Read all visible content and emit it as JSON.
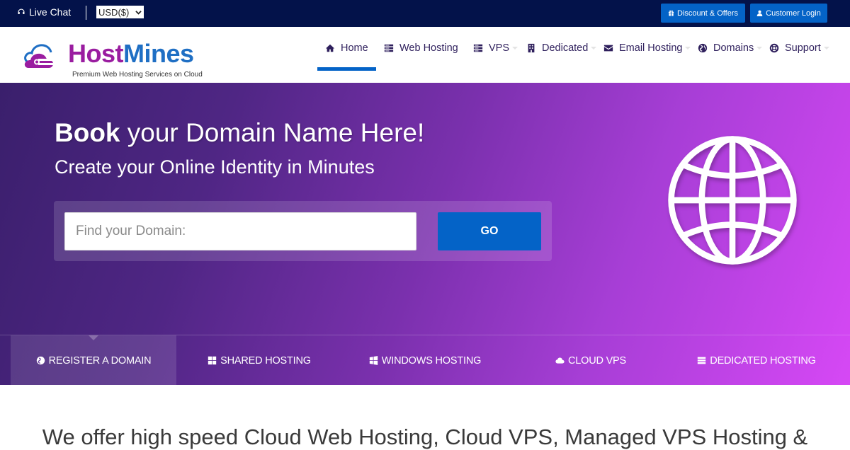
{
  "topbar": {
    "live_chat": "Live Chat",
    "currency": "USD($)",
    "discount_button": "Discount & Offers",
    "login_button": "Customer Login"
  },
  "brand": {
    "name_part1": "Host",
    "name_part2": "Mines",
    "tagline": "Premium Web Hosting Services on Cloud",
    "colors": {
      "host": "#9a1da0",
      "mines": "#1f6fc4"
    }
  },
  "nav": {
    "active": "Home",
    "items": [
      {
        "label": "Home",
        "icon": "home-icon",
        "has_dropdown": false
      },
      {
        "label": "Web Hosting",
        "icon": "server-icon",
        "has_dropdown": false
      },
      {
        "label": "VPS",
        "icon": "server-icon",
        "has_dropdown": true
      },
      {
        "label": "Dedicated",
        "icon": "building-icon",
        "has_dropdown": true
      },
      {
        "label": "Email Hosting",
        "icon": "envelope-icon",
        "has_dropdown": true
      },
      {
        "label": "Domains",
        "icon": "globe-icon",
        "has_dropdown": true
      },
      {
        "label": "Support",
        "icon": "life-ring-icon",
        "has_dropdown": true
      }
    ]
  },
  "hero": {
    "title_bold": "Book",
    "title_rest": " your Domain Name Here!",
    "subtitle": "Create your Online Identity in Minutes",
    "search_placeholder": "Find your Domain:",
    "search_value": "",
    "go_button": "GO"
  },
  "tabs": {
    "active": "REGISTER A DOMAIN",
    "items": [
      {
        "label": "REGISTER A DOMAIN",
        "icon": "globe-icon"
      },
      {
        "label": "SHARED HOSTING",
        "icon": "grid-icon"
      },
      {
        "label": "WINDOWS HOSTING",
        "icon": "windows-icon"
      },
      {
        "label": "CLOUD VPS",
        "icon": "cloud-icon"
      },
      {
        "label": "DEDICATED HOSTING",
        "icon": "server-icon"
      }
    ]
  },
  "intro": {
    "text": "We offer high speed Cloud Web Hosting, Cloud VPS, Managed VPS Hosting &"
  },
  "colors": {
    "topbar_bg": "#03124a",
    "accent_blue": "#0463c7",
    "nav_text": "#2e1f5c",
    "hero_gradient_start": "#3a1f6c",
    "hero_gradient_end": "#d648f5"
  }
}
